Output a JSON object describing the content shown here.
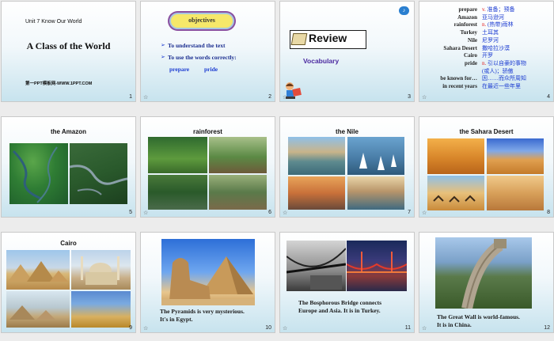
{
  "slides": {
    "s1": {
      "unit": "Unit 7 Know Our World",
      "title": "A Class of the World",
      "footer": "第一PPT模板网-WWW.1PPT.COM",
      "num": "1"
    },
    "s2": {
      "badge": "objectives",
      "obj1": "To understand the text",
      "obj2": "To use the words correctly:",
      "word1": "prepare",
      "word2": "pride",
      "num": "2"
    },
    "s3": {
      "review": "Review",
      "subtitle": "Vocabulary",
      "num": "3"
    },
    "s4": {
      "items": [
        {
          "word": "prepare",
          "pos": "v.",
          "def": "准备；预备"
        },
        {
          "word": "Amazon",
          "pos": "",
          "def": "亚马逊河"
        },
        {
          "word": "rainforest",
          "pos": "n.",
          "def": "(热带)雨林"
        },
        {
          "word": "Turkey",
          "pos": "",
          "def": "土耳其"
        },
        {
          "word": "Nile",
          "pos": "",
          "def": "尼罗河"
        },
        {
          "word": "Sahara Desert",
          "pos": "",
          "def": "撒哈拉沙漠"
        },
        {
          "word": "Cairo",
          "pos": "",
          "def": "开罗"
        },
        {
          "word": "pride",
          "pos": "n.",
          "def": "引以自豪的事物"
        },
        {
          "word": "",
          "pos": "",
          "def": "(或人)；骄傲"
        },
        {
          "word": "be known for…",
          "pos": "",
          "def": "因……而众所周知"
        },
        {
          "word": "in recent years",
          "pos": "",
          "def": "在最近一些年里"
        }
      ],
      "num": "4"
    },
    "s5": {
      "title": "the Amazon",
      "num": "5"
    },
    "s6": {
      "title": "rainforest",
      "num": "6"
    },
    "s7": {
      "title": "the Nile",
      "num": "7"
    },
    "s8": {
      "title": "the Sahara Desert",
      "num": "8"
    },
    "s9": {
      "title": "Cairo",
      "num": "9"
    },
    "s10": {
      "cap1": "The Pyramids is very mysterious.",
      "cap2": "It's in Egypt.",
      "num": "10"
    },
    "s11": {
      "cap1": "The Bosphorous Bridge connects",
      "cap2": "Europe and Asia. It is in Turkey.",
      "num": "11"
    },
    "s12": {
      "cap1": "The Great Wall  is world-famous.",
      "cap2": "It is in China.",
      "num": "12"
    }
  },
  "icons": {
    "star": "☆"
  },
  "colors": {
    "blue_text": "#1b3bd1",
    "red_pos": "#e21b1b",
    "badge": "#f6e86a"
  }
}
